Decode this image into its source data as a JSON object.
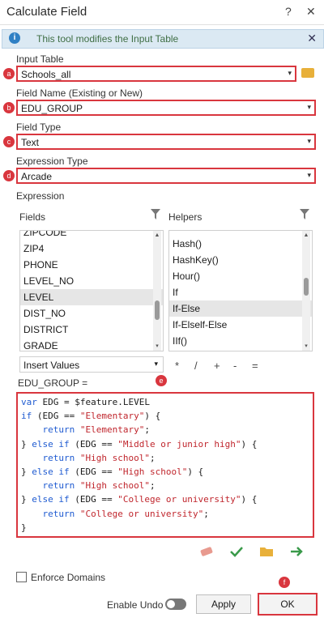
{
  "window": {
    "title": "Calculate Field",
    "help": "?",
    "close": "✕"
  },
  "info": {
    "message": "This tool modifies the Input Table",
    "icon": "i",
    "close": "✕"
  },
  "input_table": {
    "label": "Input Table",
    "value": "Schools_all",
    "badge": "a"
  },
  "field_name": {
    "label": "Field Name (Existing or New)",
    "value": "EDU_GROUP",
    "badge": "b"
  },
  "field_type": {
    "label": "Field Type",
    "value": "Text",
    "badge": "c"
  },
  "expression_type": {
    "label": "Expression Type",
    "value": "Arcade",
    "badge": "d"
  },
  "expression": {
    "label": "Expression"
  },
  "fields": {
    "label": "Fields",
    "items": [
      "ZIPCODE",
      "ZIP4",
      "PHONE",
      "LEVEL_NO",
      "LEVEL",
      "DIST_NO",
      "DISTRICT",
      "GRADE"
    ],
    "selected": "LEVEL"
  },
  "helpers": {
    "label": "Helpers",
    "items": [
      "Hash()",
      "HashKey()",
      "Hour()",
      "If",
      "If-Else",
      "If-Elself-Else",
      "IIf()"
    ],
    "selected": "If-Else"
  },
  "insert": {
    "value": "Insert Values"
  },
  "operators": [
    "*",
    "/",
    "+",
    "-",
    "="
  ],
  "code": {
    "header": "EDU_GROUP =",
    "badge": "e"
  },
  "enforce_domains": {
    "label": "Enforce Domains"
  },
  "enable_undo": {
    "label": "Enable Undo"
  },
  "buttons": {
    "apply": "Apply",
    "ok": "OK",
    "badge": "f"
  },
  "arrows": {
    "down": "▾",
    "up": "▲"
  },
  "colors": {
    "accent_red": "#d9363e",
    "info_bg": "#dbe9f3",
    "keyword_blue": "#1f5bd1",
    "string_red": "#c0262d"
  }
}
